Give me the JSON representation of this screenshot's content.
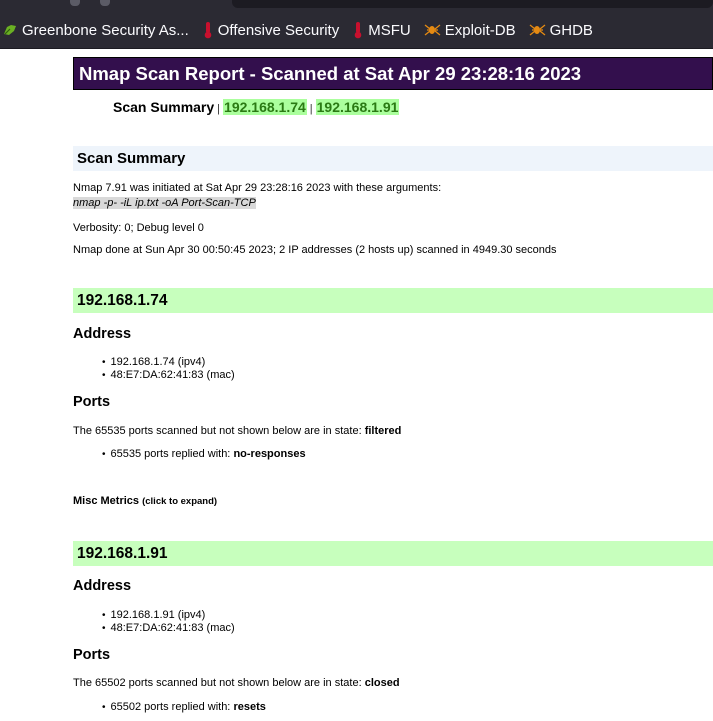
{
  "bookmarks": [
    {
      "label": "Greenbone Security As...",
      "icon": "greenbone-icon",
      "color": "#6ab023"
    },
    {
      "label": "Offensive Security",
      "icon": "offsec-icon",
      "color": "#c8102e"
    },
    {
      "label": "MSFU",
      "icon": "offsec-icon",
      "color": "#c8102e"
    },
    {
      "label": "Exploit-DB",
      "icon": "exploitdb-icon",
      "color": "#e58a12"
    },
    {
      "label": "GHDB",
      "icon": "exploitdb-icon",
      "color": "#e58a12"
    }
  ],
  "report": {
    "title": "Nmap Scan Report - Scanned at Sat Apr 29 23:28:16 2023",
    "nav": {
      "label": "Scan Summary",
      "sep": "|",
      "hosts": [
        "192.168.1.74",
        "192.168.1.91"
      ]
    },
    "summary": {
      "heading": "Scan Summary",
      "init_line": "Nmap 7.91 was initiated at Sat Apr 29 23:28:16 2023 with these arguments:",
      "command": "nmap -p- -iL ip.txt -oA Port-Scan-TCP",
      "verbosity": "Verbosity: 0; Debug level 0",
      "done_line": "Nmap done at Sun Apr 30 00:50:45 2023; 2 IP addresses (2 hosts up) scanned in 4949.30 seconds"
    },
    "hosts": [
      {
        "ip": "192.168.1.74",
        "address_heading": "Address",
        "addresses": [
          "192.168.1.74 (ipv4)",
          "48:E7:DA:62:41:83 (mac)"
        ],
        "ports_heading": "Ports",
        "ports_text": "The 65535 ports scanned but not shown below are in state: ",
        "ports_state": "filtered",
        "reply_text": "65535 ports replied with: ",
        "reply_reason": "no-responses",
        "misc_label": "Misc Metrics",
        "misc_hint": "(click to expand)"
      },
      {
        "ip": "192.168.1.91",
        "address_heading": "Address",
        "addresses": [
          "192.168.1.91 (ipv4)",
          "48:E7:DA:62:41:83 (mac)"
        ],
        "ports_heading": "Ports",
        "ports_text": "The 65502 ports scanned but not shown below are in state: ",
        "ports_state": "closed",
        "reply_text": "65502 ports replied with: ",
        "reply_reason": "resets"
      }
    ]
  }
}
